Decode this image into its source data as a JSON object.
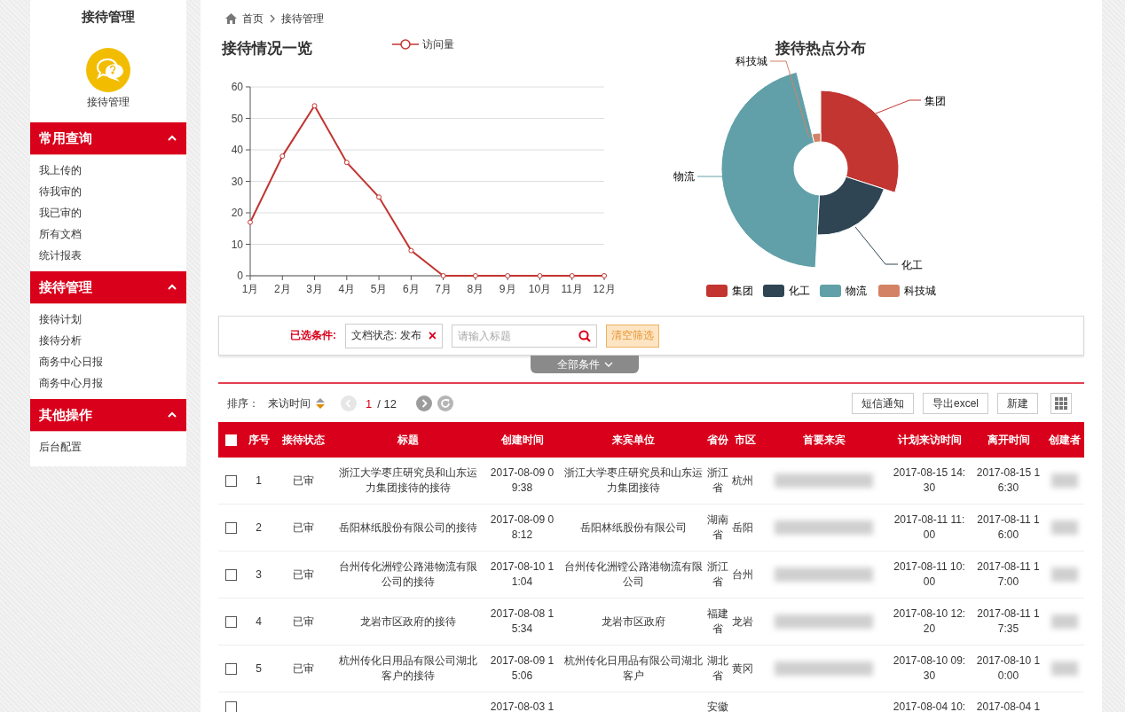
{
  "sidebar": {
    "title": "接待管理",
    "module_label": "接待管理",
    "sections": [
      {
        "title": "常用查询",
        "expanded": true,
        "items": [
          "我上传的",
          "待我审的",
          "我已审的",
          "所有文档",
          "统计报表"
        ]
      },
      {
        "title": "接待管理",
        "expanded": true,
        "items": [
          "接待计划",
          "接待分析",
          "商务中心日报",
          "商务中心月报"
        ]
      },
      {
        "title": "其他操作",
        "expanded": true,
        "items": [
          "后台配置"
        ]
      }
    ]
  },
  "breadcrumb": [
    "首页",
    "接待管理"
  ],
  "visits_chart": {
    "chart_data": {
      "type": "line",
      "title": "接待情况一览",
      "categories": [
        "1月",
        "2月",
        "3月",
        "4月",
        "5月",
        "6月",
        "7月",
        "8月",
        "9月",
        "10月",
        "11月",
        "12月"
      ],
      "series": [
        {
          "name": "访问量",
          "color": "#c23531",
          "marker": "circle",
          "values": [
            17,
            38,
            54,
            36,
            25,
            8,
            0,
            0,
            0,
            0,
            0,
            0
          ]
        }
      ],
      "grid": true,
      "ylim": [
        0,
        60
      ],
      "yticks": [
        0,
        10,
        20,
        30,
        40,
        50,
        60
      ]
    }
  },
  "hotspot_chart": {
    "title": "接待热点分布",
    "slices": [
      {
        "label": "集团",
        "color": "#c23531"
      },
      {
        "label": "化工",
        "color": "#2f4554"
      },
      {
        "label": "物流",
        "color": "#61a0a8"
      },
      {
        "label": "科技城",
        "color": "#d48265"
      }
    ],
    "legend": [
      {
        "label": "集团",
        "color": "#c23531"
      },
      {
        "label": "化工",
        "color": "#2f4554"
      },
      {
        "label": "物流",
        "color": "#61a0a8"
      },
      {
        "label": "科技城",
        "color": "#d48265"
      }
    ]
  },
  "filters": {
    "label": "已选条件:",
    "chips": [
      {
        "label": "文档状态: 发布",
        "remove": "×"
      }
    ],
    "search": {
      "placeholder": "请输入标题"
    },
    "clear_button": "清空筛选",
    "expand_tab": "全部条件"
  },
  "toolbar": {
    "sort_label": "排序：",
    "sort_field": "来访时间",
    "page": "1",
    "page_total": "/ 12",
    "buttons": [
      "短信通知",
      "导出excel",
      "新建"
    ]
  },
  "table": {
    "header_checked": false,
    "columns": [
      "序号",
      "接待状态",
      "标题",
      "创建时间",
      "来宾单位",
      "省份",
      "市区",
      "首要来宾",
      "计划来访时间",
      "离开时间",
      "创建者"
    ],
    "rows": [
      {
        "checked": false,
        "no": "1",
        "status": "已审",
        "title": "浙江大学枣庄研究员和山东运力集团接待的接待",
        "created": "2017-08-09 09:38",
        "unit": "浙江大学枣庄研究员和山东运力集团接待",
        "province": "浙江省",
        "city": "杭州",
        "planned": "2017-08-15 14:30",
        "leave": "2017-08-15 16:30"
      },
      {
        "checked": false,
        "no": "2",
        "status": "已审",
        "title": "岳阳林纸股份有限公司的接待",
        "created": "2017-08-09 08:12",
        "unit": "岳阳林纸股份有限公司",
        "province": "湖南省",
        "city": "岳阳",
        "planned": "2017-08-11 11:00",
        "leave": "2017-08-11 16:00"
      },
      {
        "checked": false,
        "no": "3",
        "status": "已审",
        "title": "台州传化洲镗公路港物流有限公司的接待",
        "created": "2017-08-10 11:04",
        "unit": "台州传化洲镗公路港物流有限公司",
        "province": "浙江省",
        "city": "台州",
        "planned": "2017-08-11 10:00",
        "leave": "2017-08-11 17:00"
      },
      {
        "checked": false,
        "no": "4",
        "status": "已审",
        "title": "龙岩市区政府的接待",
        "created": "2017-08-08 15:34",
        "unit": "龙岩市区政府",
        "province": "福建省",
        "city": "龙岩",
        "planned": "2017-08-10 12:20",
        "leave": "2017-08-11 17:35"
      },
      {
        "checked": false,
        "no": "5",
        "status": "已审",
        "title": "杭州传化日用品有限公司湖北客户的接待",
        "created": "2017-08-09 15:06",
        "unit": "杭州传化日用品有限公司湖北客户",
        "province": "湖北省",
        "city": "黄冈",
        "planned": "2017-08-10 09:30",
        "leave": "2017-08-10 10:00"
      },
      {
        "checked": false,
        "created": "2017-08-03 1",
        "province": "安徽",
        "planned": "2017-08-04 10:",
        "leave": "2017-08-04 1"
      }
    ]
  }
}
